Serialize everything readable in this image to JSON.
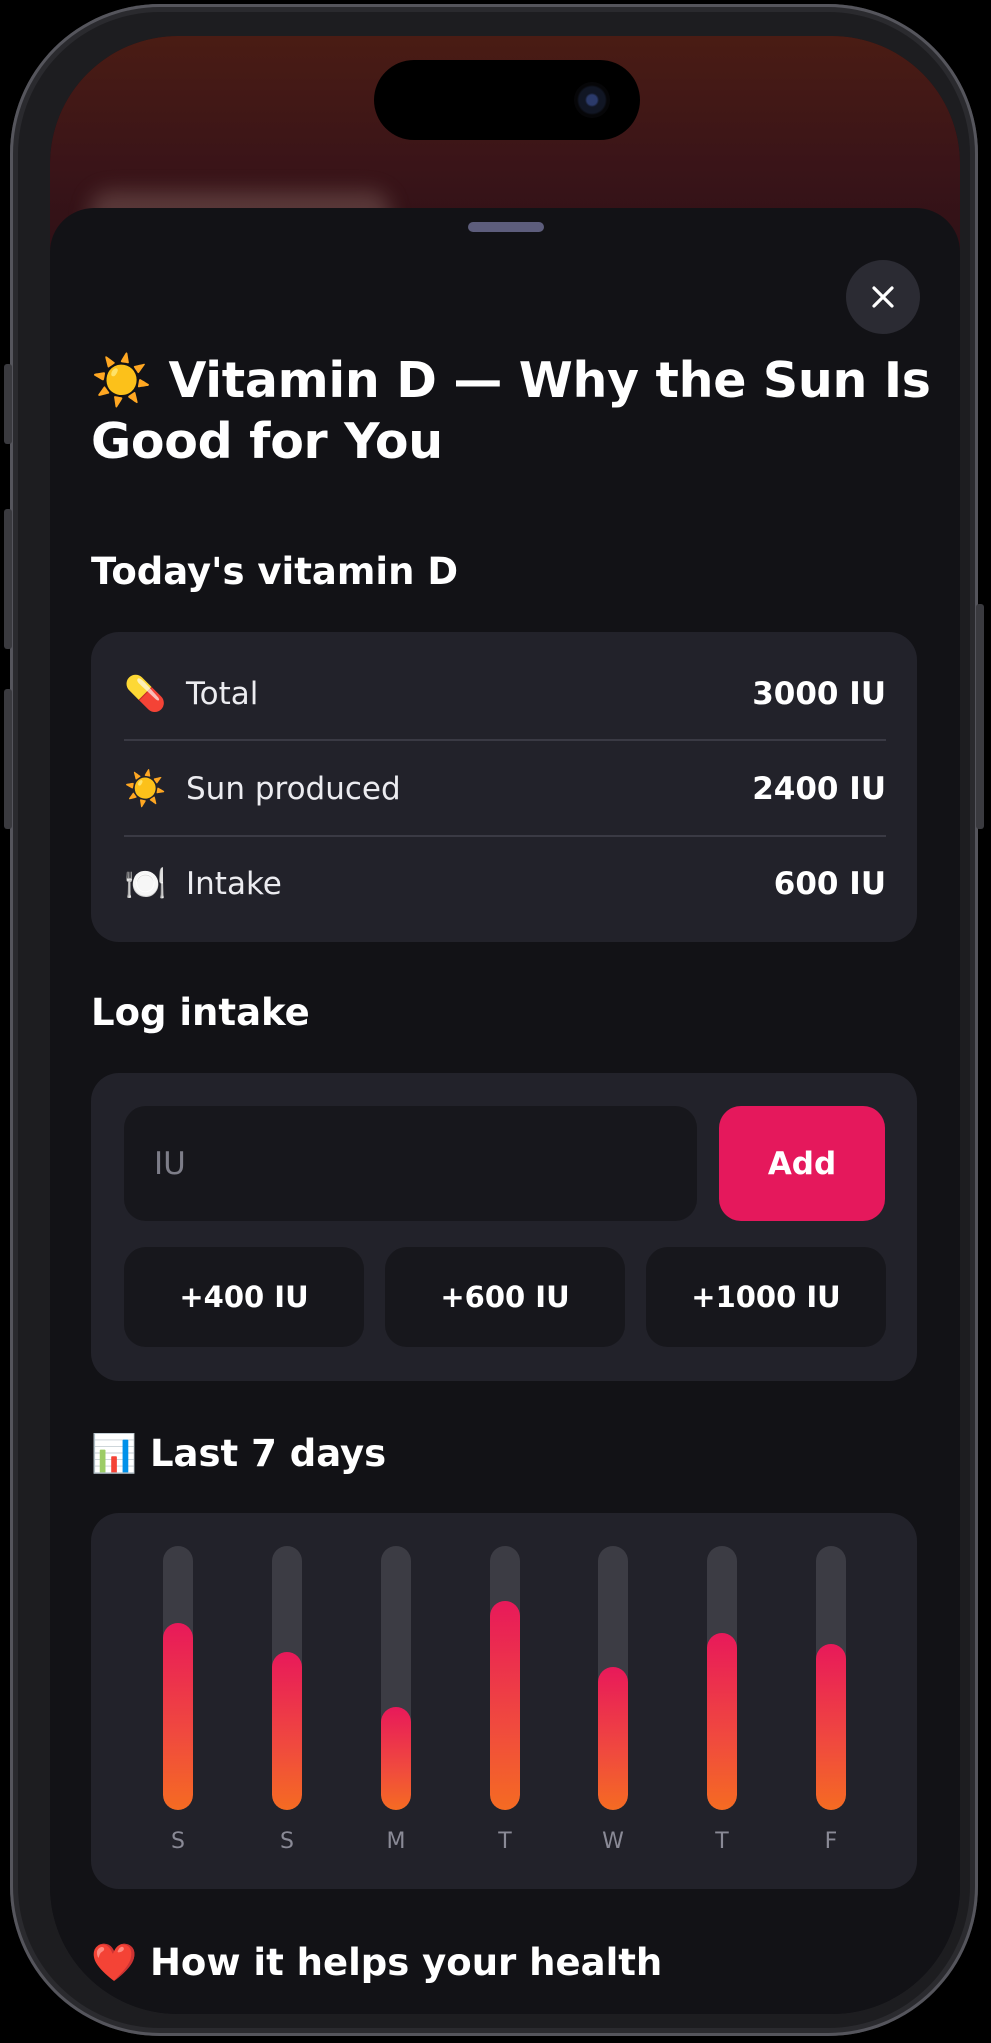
{
  "sheet": {
    "title": "☀️ Vitamin D — Why the Sun Is Good for You",
    "close_icon": "close-icon"
  },
  "today": {
    "heading": "Today's vitamin D",
    "rows": [
      {
        "icon": "💊",
        "icon_name": "pill-icon",
        "label": "Total",
        "value": "3000 IU"
      },
      {
        "icon": "☀️",
        "icon_name": "sun-icon",
        "label": "Sun produced",
        "value": "2400 IU"
      },
      {
        "icon": "🍽️",
        "icon_name": "plate-icon",
        "label": "Intake",
        "value": "600 IU"
      }
    ]
  },
  "log": {
    "heading": "Log intake",
    "input_placeholder": "IU",
    "input_value": "",
    "add_label": "Add",
    "quick": [
      "+400 IU",
      "+600 IU",
      "+1000 IU"
    ]
  },
  "history": {
    "heading": "📊 Last 7 days",
    "days": [
      "S",
      "S",
      "M",
      "T",
      "W",
      "T",
      "F"
    ],
    "levels": [
      0.71,
      0.6,
      0.39,
      0.79,
      0.54,
      0.67,
      0.63
    ]
  },
  "health": {
    "heading": "❤️ How it helps your health"
  },
  "colors": {
    "accent": "#e5185c",
    "bar_gradient_top": "#e8195a",
    "bar_gradient_bottom": "#f56b22",
    "sheet_background": "#121216",
    "card_background": "#22222a"
  }
}
